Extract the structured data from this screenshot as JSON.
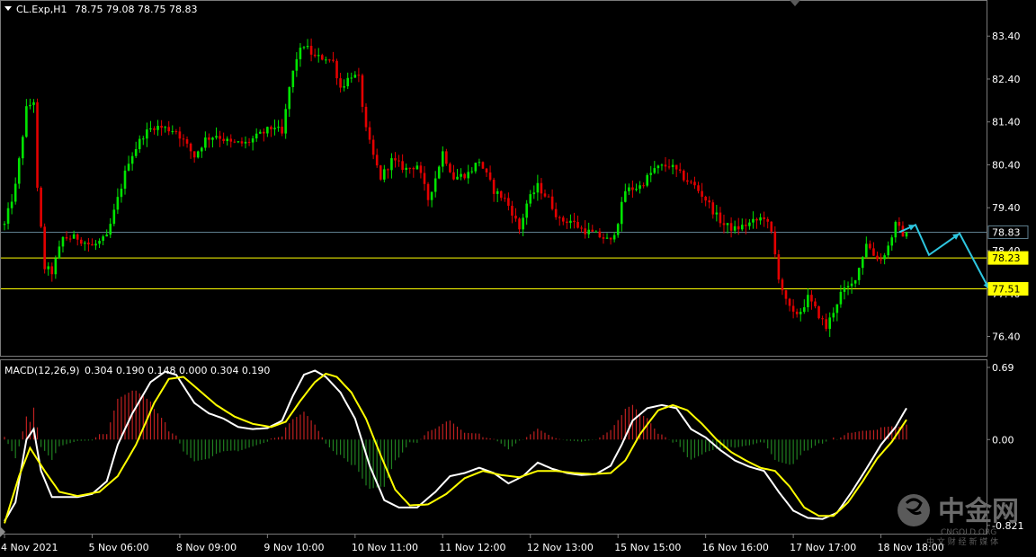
{
  "window": {
    "symbol_info": "CL.Exp,H1",
    "ohlc": "78.75 79.08 78.75 78.83",
    "menu_icon": "triangle-down-icon"
  },
  "macd": {
    "label": "MACD(12,26,9)",
    "values_text": "0.304 0.190 0.148 0.000 0.304 0.190"
  },
  "colors": {
    "background": "#000000",
    "bull": "#00e400",
    "bear": "#e40000",
    "grid_line": "#3a4a5a",
    "level_line": "#ffff00",
    "current_price_line": "#5f7f8f",
    "arrow": "#2ec6e0",
    "macd_line": "#ffffff",
    "signal_line": "#ffff00",
    "hist_pos": "#c02020",
    "hist_neg": "#208020"
  },
  "price_tags": {
    "current": "78.83",
    "level1": "78.23",
    "level2": "77.51"
  },
  "watermark": {
    "brand": "中金网",
    "domain": "CNGOLD.ORG",
    "slogan": "中 文 财 经 新 媒 体",
    "logo_icon": "cngold-logo-icon"
  },
  "chart_data": {
    "type": "candlestick",
    "price_axis": {
      "ticks": [
        "83.40",
        "82.40",
        "81.40",
        "80.40",
        "79.40",
        "78.40",
        "76.40"
      ],
      "tick_values": [
        83.4,
        82.4,
        81.4,
        80.4,
        79.4,
        78.4,
        76.4
      ],
      "range": [
        75.95,
        84.2
      ],
      "partially_hidden_tick": "77.40"
    },
    "macd_axis": {
      "ticks": [
        "0.69",
        "0.00",
        "-0.821"
      ],
      "tick_values": [
        0.69,
        0.0,
        -0.821
      ],
      "range": [
        -0.9,
        0.75
      ]
    },
    "time_axis": {
      "labels": [
        "4 Nov 2021",
        "5 Nov 06:00",
        "8 Nov 09:00",
        "9 Nov 10:00",
        "10 Nov 11:00",
        "11 Nov 12:00",
        "12 Nov 13:00",
        "15 Nov 15:00",
        "16 Nov 16:00",
        "17 Nov 17:00",
        "18 Nov 18:00"
      ],
      "label_bar_index": [
        0,
        24,
        48,
        72,
        96,
        120,
        144,
        168,
        192,
        216,
        240
      ]
    },
    "horizontal_levels": [
      78.83,
      78.23,
      77.51
    ],
    "waypoints": [
      [
        0,
        79.0
      ],
      [
        3,
        79.9
      ],
      [
        6,
        81.7
      ],
      [
        8,
        81.9
      ],
      [
        9,
        79.8
      ],
      [
        11,
        78.0
      ],
      [
        13,
        77.9
      ],
      [
        16,
        78.7
      ],
      [
        20,
        78.7
      ],
      [
        24,
        78.5
      ],
      [
        28,
        78.7
      ],
      [
        31,
        79.6
      ],
      [
        34,
        80.5
      ],
      [
        38,
        81.1
      ],
      [
        41,
        81.3
      ],
      [
        47,
        81.2
      ],
      [
        52,
        80.6
      ],
      [
        55,
        81.0
      ],
      [
        58,
        81.1
      ],
      [
        62,
        80.9
      ],
      [
        66,
        80.9
      ],
      [
        70,
        81.1
      ],
      [
        74,
        81.3
      ],
      [
        76,
        81.1
      ],
      [
        78,
        82.2
      ],
      [
        80,
        82.9
      ],
      [
        82,
        83.2
      ],
      [
        85,
        82.9
      ],
      [
        88,
        82.9
      ],
      [
        90,
        82.8
      ],
      [
        92,
        82.2
      ],
      [
        95,
        82.5
      ],
      [
        97,
        82.4
      ],
      [
        99,
        81.2
      ],
      [
        101,
        80.6
      ],
      [
        103,
        80.1
      ],
      [
        106,
        80.5
      ],
      [
        110,
        80.3
      ],
      [
        113,
        80.4
      ],
      [
        116,
        79.6
      ],
      [
        118,
        80.1
      ],
      [
        120,
        80.7
      ],
      [
        123,
        80.1
      ],
      [
        127,
        80.2
      ],
      [
        130,
        80.5
      ],
      [
        134,
        79.8
      ],
      [
        137,
        79.6
      ],
      [
        139,
        79.3
      ],
      [
        141,
        78.9
      ],
      [
        143,
        79.5
      ],
      [
        146,
        79.9
      ],
      [
        149,
        79.6
      ],
      [
        152,
        79.1
      ],
      [
        155,
        79.1
      ],
      [
        158,
        78.9
      ],
      [
        161,
        78.8
      ],
      [
        164,
        78.7
      ],
      [
        166,
        78.6
      ],
      [
        168,
        79.1
      ],
      [
        170,
        79.8
      ],
      [
        174,
        79.9
      ],
      [
        178,
        80.3
      ],
      [
        182,
        80.4
      ],
      [
        186,
        80.1
      ],
      [
        189,
        79.9
      ],
      [
        192,
        79.6
      ],
      [
        195,
        79.2
      ],
      [
        197,
        79.0
      ],
      [
        200,
        78.9
      ],
      [
        203,
        79.0
      ],
      [
        206,
        79.1
      ],
      [
        208,
        79.2
      ],
      [
        210,
        78.8
      ],
      [
        212,
        77.8
      ],
      [
        214,
        77.2
      ],
      [
        216,
        76.9
      ],
      [
        218,
        77.0
      ],
      [
        220,
        77.3
      ],
      [
        223,
        76.9
      ],
      [
        225,
        76.6
      ],
      [
        227,
        77.0
      ],
      [
        229,
        77.4
      ],
      [
        232,
        77.6
      ],
      [
        234,
        78.0
      ],
      [
        236,
        78.6
      ],
      [
        238,
        78.3
      ],
      [
        240,
        78.2
      ],
      [
        242,
        78.5
      ],
      [
        244,
        79.0
      ],
      [
        246,
        78.8
      ],
      [
        247,
        78.83
      ]
    ],
    "forecast_arrows": [
      [
        78.83,
        79.0,
        78.3,
        78.8,
        77.5
      ]
    ],
    "macd_line_waypoints": [
      [
        0,
        -0.78
      ],
      [
        3,
        -0.6
      ],
      [
        6,
        0.0
      ],
      [
        8,
        0.1
      ],
      [
        10,
        -0.3
      ],
      [
        13,
        -0.55
      ],
      [
        16,
        -0.55
      ],
      [
        20,
        -0.55
      ],
      [
        24,
        -0.52
      ],
      [
        28,
        -0.4
      ],
      [
        31,
        -0.05
      ],
      [
        35,
        0.25
      ],
      [
        40,
        0.55
      ],
      [
        44,
        0.65
      ],
      [
        47,
        0.62
      ],
      [
        52,
        0.35
      ],
      [
        56,
        0.25
      ],
      [
        60,
        0.2
      ],
      [
        64,
        0.12
      ],
      [
        68,
        0.1
      ],
      [
        72,
        0.11
      ],
      [
        76,
        0.18
      ],
      [
        79,
        0.42
      ],
      [
        82,
        0.62
      ],
      [
        85,
        0.66
      ],
      [
        88,
        0.6
      ],
      [
        92,
        0.45
      ],
      [
        96,
        0.2
      ],
      [
        100,
        -0.25
      ],
      [
        104,
        -0.58
      ],
      [
        108,
        -0.65
      ],
      [
        113,
        -0.65
      ],
      [
        118,
        -0.5
      ],
      [
        122,
        -0.35
      ],
      [
        126,
        -0.32
      ],
      [
        130,
        -0.27
      ],
      [
        134,
        -0.32
      ],
      [
        138,
        -0.42
      ],
      [
        142,
        -0.35
      ],
      [
        146,
        -0.22
      ],
      [
        150,
        -0.28
      ],
      [
        154,
        -0.32
      ],
      [
        158,
        -0.34
      ],
      [
        162,
        -0.33
      ],
      [
        166,
        -0.25
      ],
      [
        169,
        -0.05
      ],
      [
        172,
        0.18
      ],
      [
        176,
        0.3
      ],
      [
        180,
        0.33
      ],
      [
        184,
        0.3
      ],
      [
        188,
        0.1
      ],
      [
        192,
        0.02
      ],
      [
        196,
        -0.1
      ],
      [
        200,
        -0.2
      ],
      [
        204,
        -0.26
      ],
      [
        208,
        -0.3
      ],
      [
        212,
        -0.5
      ],
      [
        216,
        -0.68
      ],
      [
        220,
        -0.75
      ],
      [
        224,
        -0.76
      ],
      [
        228,
        -0.7
      ],
      [
        232,
        -0.5
      ],
      [
        236,
        -0.28
      ],
      [
        240,
        -0.05
      ],
      [
        244,
        0.12
      ],
      [
        247,
        0.3
      ]
    ],
    "signal_line_waypoints": [
      [
        0,
        -0.8
      ],
      [
        4,
        -0.35
      ],
      [
        7,
        -0.08
      ],
      [
        11,
        -0.3
      ],
      [
        15,
        -0.5
      ],
      [
        20,
        -0.54
      ],
      [
        26,
        -0.5
      ],
      [
        31,
        -0.35
      ],
      [
        36,
        -0.05
      ],
      [
        41,
        0.35
      ],
      [
        45,
        0.58
      ],
      [
        49,
        0.6
      ],
      [
        53,
        0.48
      ],
      [
        58,
        0.33
      ],
      [
        63,
        0.22
      ],
      [
        68,
        0.15
      ],
      [
        73,
        0.12
      ],
      [
        77,
        0.17
      ],
      [
        81,
        0.37
      ],
      [
        85,
        0.55
      ],
      [
        88,
        0.63
      ],
      [
        91,
        0.6
      ],
      [
        95,
        0.45
      ],
      [
        99,
        0.2
      ],
      [
        103,
        -0.15
      ],
      [
        107,
        -0.48
      ],
      [
        111,
        -0.63
      ],
      [
        116,
        -0.62
      ],
      [
        121,
        -0.52
      ],
      [
        126,
        -0.37
      ],
      [
        131,
        -0.3
      ],
      [
        136,
        -0.34
      ],
      [
        141,
        -0.36
      ],
      [
        146,
        -0.3
      ],
      [
        151,
        -0.3
      ],
      [
        156,
        -0.32
      ],
      [
        161,
        -0.33
      ],
      [
        166,
        -0.32
      ],
      [
        170,
        -0.2
      ],
      [
        174,
        0.05
      ],
      [
        179,
        0.28
      ],
      [
        183,
        0.33
      ],
      [
        187,
        0.28
      ],
      [
        191,
        0.15
      ],
      [
        195,
        0.0
      ],
      [
        199,
        -0.12
      ],
      [
        203,
        -0.2
      ],
      [
        207,
        -0.27
      ],
      [
        211,
        -0.3
      ],
      [
        215,
        -0.45
      ],
      [
        219,
        -0.65
      ],
      [
        223,
        -0.73
      ],
      [
        227,
        -0.73
      ],
      [
        231,
        -0.6
      ],
      [
        235,
        -0.4
      ],
      [
        239,
        -0.18
      ],
      [
        243,
        -0.02
      ],
      [
        247,
        0.19
      ]
    ],
    "candle_count": 248
  }
}
